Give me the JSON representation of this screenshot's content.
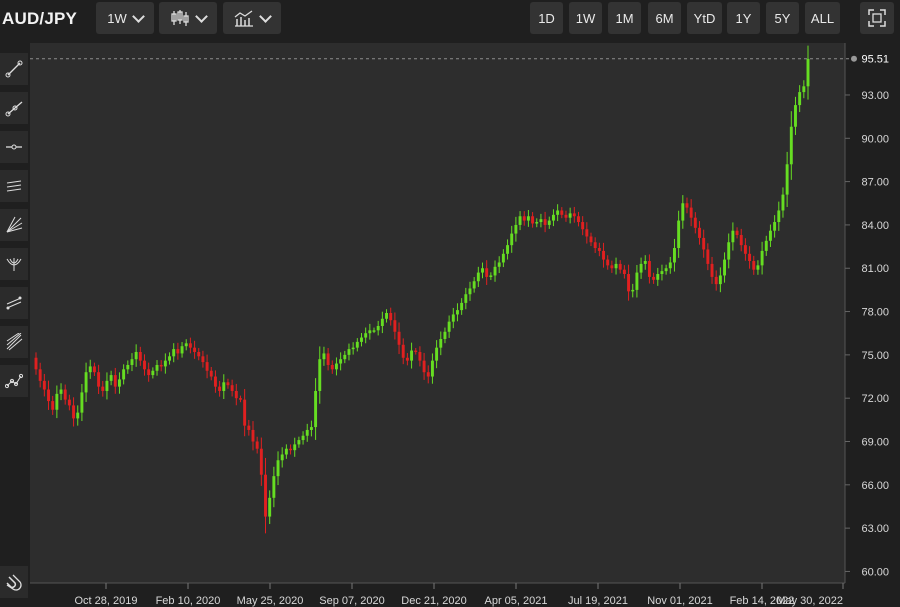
{
  "header": {
    "symbol": "AUD/JPY",
    "interval_label": "1W",
    "chart_type_icon": "candlestick-icon",
    "indicators_icon": "indicators-icon",
    "ranges": [
      "1D",
      "1W",
      "1M",
      "6M",
      "YtD",
      "1Y",
      "5Y",
      "ALL"
    ],
    "fullscreen_icon": "fullscreen-icon"
  },
  "tools": [
    "trend-line-icon",
    "ray-icon",
    "horizontal-line-icon",
    "parallel-channel-icon",
    "fan-icon",
    "pitchfork-icon",
    "regression-channel-icon",
    "pitchfan-icon",
    "polyline-icon",
    "magnet-icon"
  ],
  "colors": {
    "up": "#66dd22",
    "down": "#e02020",
    "background": "#2d2d2d",
    "last_price": "#8d8d8d"
  },
  "chart_data": {
    "type": "candlestick",
    "interval": "weekly",
    "y_ticks": [
      "60.00",
      "63.00",
      "66.00",
      "69.00",
      "72.00",
      "75.00",
      "78.00",
      "81.00",
      "84.00",
      "87.00",
      "90.00",
      "93.00"
    ],
    "x_ticks": [
      "Oct 28, 2019",
      "Feb 10, 2020",
      "May 25, 2020",
      "Sep 07, 2020",
      "Dec 21, 2020",
      "Apr 05, 2021",
      "Jul 19, 2021",
      "Nov 01, 2021",
      "Feb 14, 2022",
      "May 30, 2022"
    ],
    "ylim": [
      59.2,
      96.6
    ],
    "last_price": "95.51",
    "grid": false,
    "weekly_close": [
      74.0,
      73.2,
      72.6,
      71.8,
      71.2,
      72.3,
      72.6,
      71.9,
      71.5,
      70.6,
      71.0,
      72.4,
      73.8,
      74.2,
      73.8,
      72.8,
      72.5,
      73.2,
      73.6,
      72.8,
      73.3,
      74.0,
      74.3,
      74.7,
      75.2,
      74.6,
      74.0,
      73.6,
      73.9,
      74.3,
      74.2,
      74.6,
      74.9,
      75.4,
      75.1,
      75.6,
      75.8,
      75.5,
      75.2,
      74.9,
      74.5,
      73.9,
      73.5,
      72.8,
      72.5,
      73.1,
      72.9,
      72.5,
      72.0,
      71.9,
      70.1,
      69.8,
      69.0,
      68.5,
      66.7,
      63.8,
      65.1,
      66.6,
      67.7,
      68.1,
      68.5,
      68.4,
      68.8,
      69.1,
      69.4,
      69.8,
      70.0,
      72.5,
      74.7,
      75.1,
      74.3,
      74.0,
      74.4,
      74.7,
      75.0,
      75.4,
      75.5,
      75.9,
      76.2,
      76.5,
      76.7,
      76.7,
      77.0,
      77.5,
      77.9,
      77.4,
      76.6,
      75.7,
      74.8,
      74.6,
      75.3,
      75.2,
      74.6,
      73.8,
      73.5,
      74.6,
      75.5,
      76.1,
      76.6,
      77.3,
      77.8,
      78.1,
      78.6,
      79.2,
      79.6,
      80.1,
      80.7,
      81.0,
      80.4,
      80.5,
      81.1,
      81.4,
      82.0,
      82.6,
      83.4,
      84.0,
      84.6,
      84.3,
      84.6,
      84.1,
      84.2,
      84.4,
      84.0,
      84.3,
      84.7,
      85.0,
      84.7,
      84.5,
      84.8,
      84.6,
      84.2,
      83.7,
      83.2,
      82.8,
      82.4,
      82.2,
      81.6,
      81.2,
      81.0,
      81.3,
      80.9,
      80.6,
      79.4,
      79.5,
      80.7,
      81.3,
      81.5,
      80.4,
      80.2,
      80.6,
      80.8,
      81.0,
      81.4,
      82.4,
      84.3,
      85.5,
      85.2,
      84.5,
      83.8,
      83.1,
      82.3,
      81.3,
      80.4,
      79.9,
      80.5,
      81.6,
      82.8,
      83.6,
      83.3,
      82.6,
      82.0,
      81.5,
      80.9,
      81.2,
      82.2,
      82.9,
      83.6,
      84.2,
      85.0,
      86.1,
      88.2,
      90.8,
      92.3,
      93.2,
      93.6,
      95.5
    ]
  }
}
